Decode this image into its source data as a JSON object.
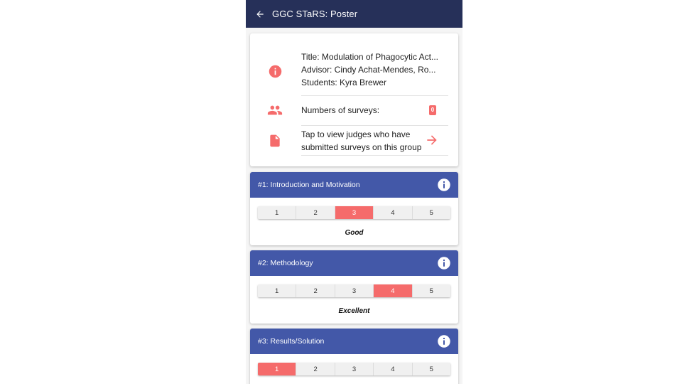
{
  "header": {
    "title": "GGC STaRS: Poster"
  },
  "info": {
    "title_line": "Title: Modulation of Phagocytic Act...",
    "advisor_line": "Advisor: Cindy Achat-Mendes, Ro...",
    "students_line": "Students: Kyra Brewer",
    "surveys_label": "Numbers of surveys:",
    "surveys_count": "0",
    "judges_line1": "Tap to view judges who have",
    "judges_line2": "submitted surveys on this group"
  },
  "criteria": [
    {
      "name": "#1: Introduction and Motivation",
      "options": [
        "1",
        "2",
        "3",
        "4",
        "5"
      ],
      "selected": 3,
      "rating": "Good"
    },
    {
      "name": "#2: Methodology",
      "options": [
        "1",
        "2",
        "3",
        "4",
        "5"
      ],
      "selected": 4,
      "rating": "Excellent"
    },
    {
      "name": "#3: Results/Solution",
      "options": [
        "1",
        "2",
        "3",
        "4",
        "5"
      ],
      "selected": 1,
      "rating": ""
    }
  ],
  "colors": {
    "header": "#263059",
    "criteria_header": "#4358a8",
    "accent": "#f56b6b"
  },
  "icons": {
    "back": "arrow-left-icon",
    "info": "info-circle-icon",
    "group": "people-icon",
    "doc": "document-icon",
    "forward": "arrow-right-icon"
  }
}
